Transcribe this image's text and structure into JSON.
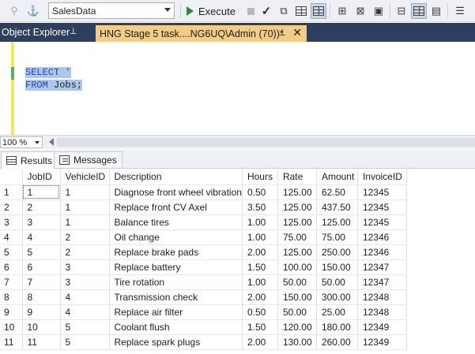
{
  "toolbar": {
    "database": "SalesData",
    "execute_label": "Execute"
  },
  "tabs": {
    "object_explorer": "Object Explorer",
    "query_tab": "HNG Stage 5 task....NG6UQ\\Admin (70))*"
  },
  "editor": {
    "line1_kw": "SELECT",
    "line1_rest": " *",
    "line2_kw": "FROM",
    "line2_rest": " Jobs;"
  },
  "zoom": "100 %",
  "results_tabs": {
    "results": "Results",
    "messages": "Messages"
  },
  "grid": {
    "columns": [
      "",
      "JobID",
      "VehicleID",
      "Description",
      "Hours",
      "Rate",
      "Amount",
      "InvoiceID"
    ],
    "rows": [
      [
        "1",
        "1",
        "1",
        "Diagnose front wheel vibration",
        "0.50",
        "125.00",
        "62.50",
        "12345"
      ],
      [
        "2",
        "2",
        "1",
        "Replace front CV Axel",
        "3.50",
        "125.00",
        "437.50",
        "12345"
      ],
      [
        "3",
        "3",
        "1",
        "Balance tires",
        "1.00",
        "125.00",
        "125.00",
        "12345"
      ],
      [
        "4",
        "4",
        "2",
        "Oil change",
        "1.00",
        "75.00",
        "75.00",
        "12346"
      ],
      [
        "5",
        "5",
        "2",
        "Replace brake pads",
        "2.00",
        "125.00",
        "250.00",
        "12346"
      ],
      [
        "6",
        "6",
        "3",
        "Replace battery",
        "1.50",
        "100.00",
        "150.00",
        "12347"
      ],
      [
        "7",
        "7",
        "3",
        "Tire rotation",
        "1.00",
        "50.00",
        "50.00",
        "12347"
      ],
      [
        "8",
        "8",
        "4",
        "Transmission check",
        "2.00",
        "150.00",
        "300.00",
        "12348"
      ],
      [
        "9",
        "9",
        "4",
        "Replace air filter",
        "0.50",
        "50.00",
        "25.00",
        "12348"
      ],
      [
        "10",
        "10",
        "5",
        "Coolant flush",
        "1.50",
        "120.00",
        "180.00",
        "12349"
      ],
      [
        "11",
        "11",
        "5",
        "Replace spark plugs",
        "2.00",
        "130.00",
        "260.00",
        "12349"
      ]
    ]
  }
}
